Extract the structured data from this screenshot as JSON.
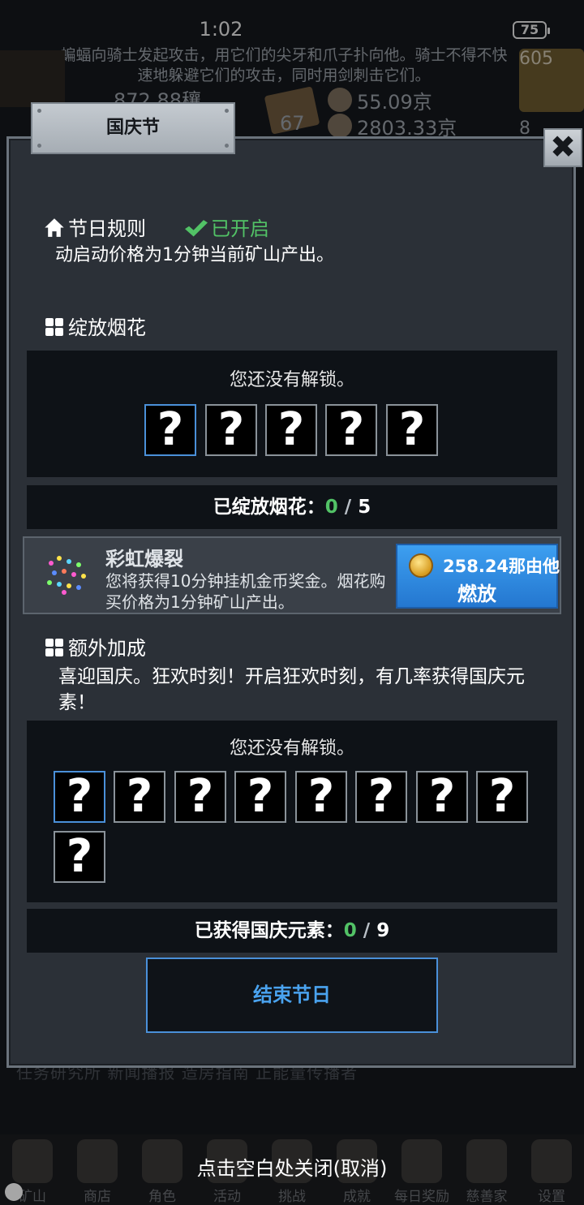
{
  "status": {
    "time": "1:02",
    "battery": "75"
  },
  "background": {
    "story": "蝙蝠向骑士发起攻击，用它们的尖牙和爪子扑向他。骑士不得不快速地躲避它们的攻击，同时用剑刺击它们。",
    "res1": "872.88穰",
    "res2": "55.09京",
    "res3": "2803.33京",
    "res4": "67",
    "res5": "605",
    "res6": "8",
    "tabs_text": "任务研究所   新闻播报   造房指南   正能量传播者"
  },
  "dialog": {
    "title": "国庆节",
    "close_label": "✖",
    "rules": {
      "heading": "节日规则",
      "status": "已开启",
      "text": "动启动价格为1分钟当前矿山产出。"
    },
    "fireworks": {
      "heading": "绽放烟花",
      "locked_text": "您还没有解锁。",
      "slot_symbol": "?",
      "count_label": "已绽放烟花：",
      "count_current": "0",
      "count_sep": " / ",
      "count_total": "5",
      "card": {
        "title": "彩虹爆裂",
        "desc": "您将获得10分钟挂机金币奖金。烟花购买价格为1分钟矿山产出。",
        "price": "258.24那由他",
        "action": "燃放"
      }
    },
    "bonus": {
      "heading": "额外加成",
      "text": "喜迎国庆。狂欢时刻！开启狂欢时刻，有几率获得国庆元素！",
      "locked_text": "您还没有解锁。",
      "count_label": "已获得国庆元素：",
      "count_current": "0",
      "count_sep": " / ",
      "count_total": "9"
    },
    "end_button": "结束节日"
  },
  "close_hint": "点击空白处关闭(取消)",
  "nav": {
    "items": [
      {
        "label": "矿山",
        "icon": "lantern-icon"
      },
      {
        "label": "商店",
        "icon": "shop-icon"
      },
      {
        "label": "角色",
        "icon": "skull-icon"
      },
      {
        "label": "活动",
        "icon": "event-icon"
      },
      {
        "label": "挑战",
        "icon": "challenge-icon"
      },
      {
        "label": "成就",
        "icon": "trophy-icon"
      },
      {
        "label": "每日奖励",
        "icon": "letter-icon"
      },
      {
        "label": "慈善家",
        "icon": "bread-icon"
      },
      {
        "label": "设置",
        "icon": "gear-icon"
      }
    ]
  },
  "colors": {
    "accent_blue": "#2477d0",
    "success_green": "#52c266",
    "panel": "#2b3037"
  }
}
